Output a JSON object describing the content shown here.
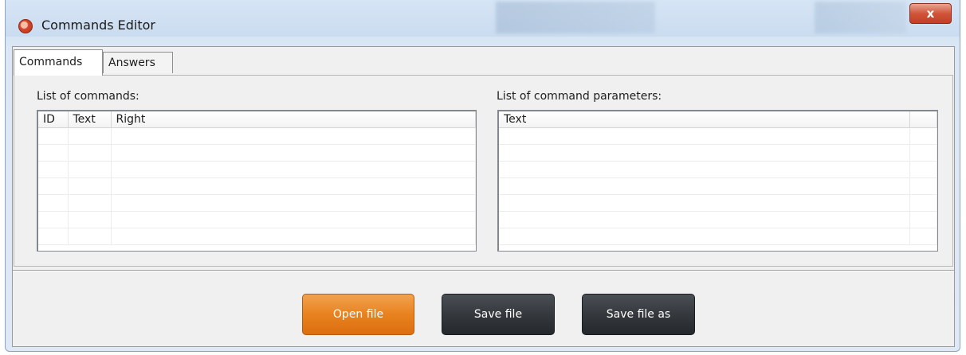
{
  "window": {
    "title": "Commands Editor",
    "close_glyph": "x"
  },
  "tabs": [
    {
      "label": "Commands",
      "active": true
    },
    {
      "label": "Answers",
      "active": false
    }
  ],
  "commands_panel": {
    "label": "List of commands:",
    "columns": [
      "ID",
      "Text",
      "Right"
    ],
    "rows": [
      [
        "",
        "",
        ""
      ],
      [
        "",
        "",
        ""
      ],
      [
        "",
        "",
        ""
      ],
      [
        "",
        "",
        ""
      ],
      [
        "",
        "",
        ""
      ],
      [
        "",
        "",
        ""
      ],
      [
        "",
        "",
        ""
      ]
    ]
  },
  "params_panel": {
    "label": "List of command parameters:",
    "columns": [
      "Text",
      ""
    ],
    "rows": [
      [
        "",
        ""
      ],
      [
        "",
        ""
      ],
      [
        "",
        ""
      ],
      [
        "",
        ""
      ],
      [
        "",
        ""
      ],
      [
        "",
        ""
      ],
      [
        "",
        ""
      ]
    ]
  },
  "buttons": {
    "open_file": "Open file",
    "save_file": "Save file",
    "save_file_as": "Save file as"
  },
  "colors": {
    "accent_orange": "#e8821f",
    "dark_button": "#35393e",
    "title_bar": "#cadcf0"
  },
  "icons": {
    "app": "app-logo-icon",
    "close": "close-icon"
  }
}
